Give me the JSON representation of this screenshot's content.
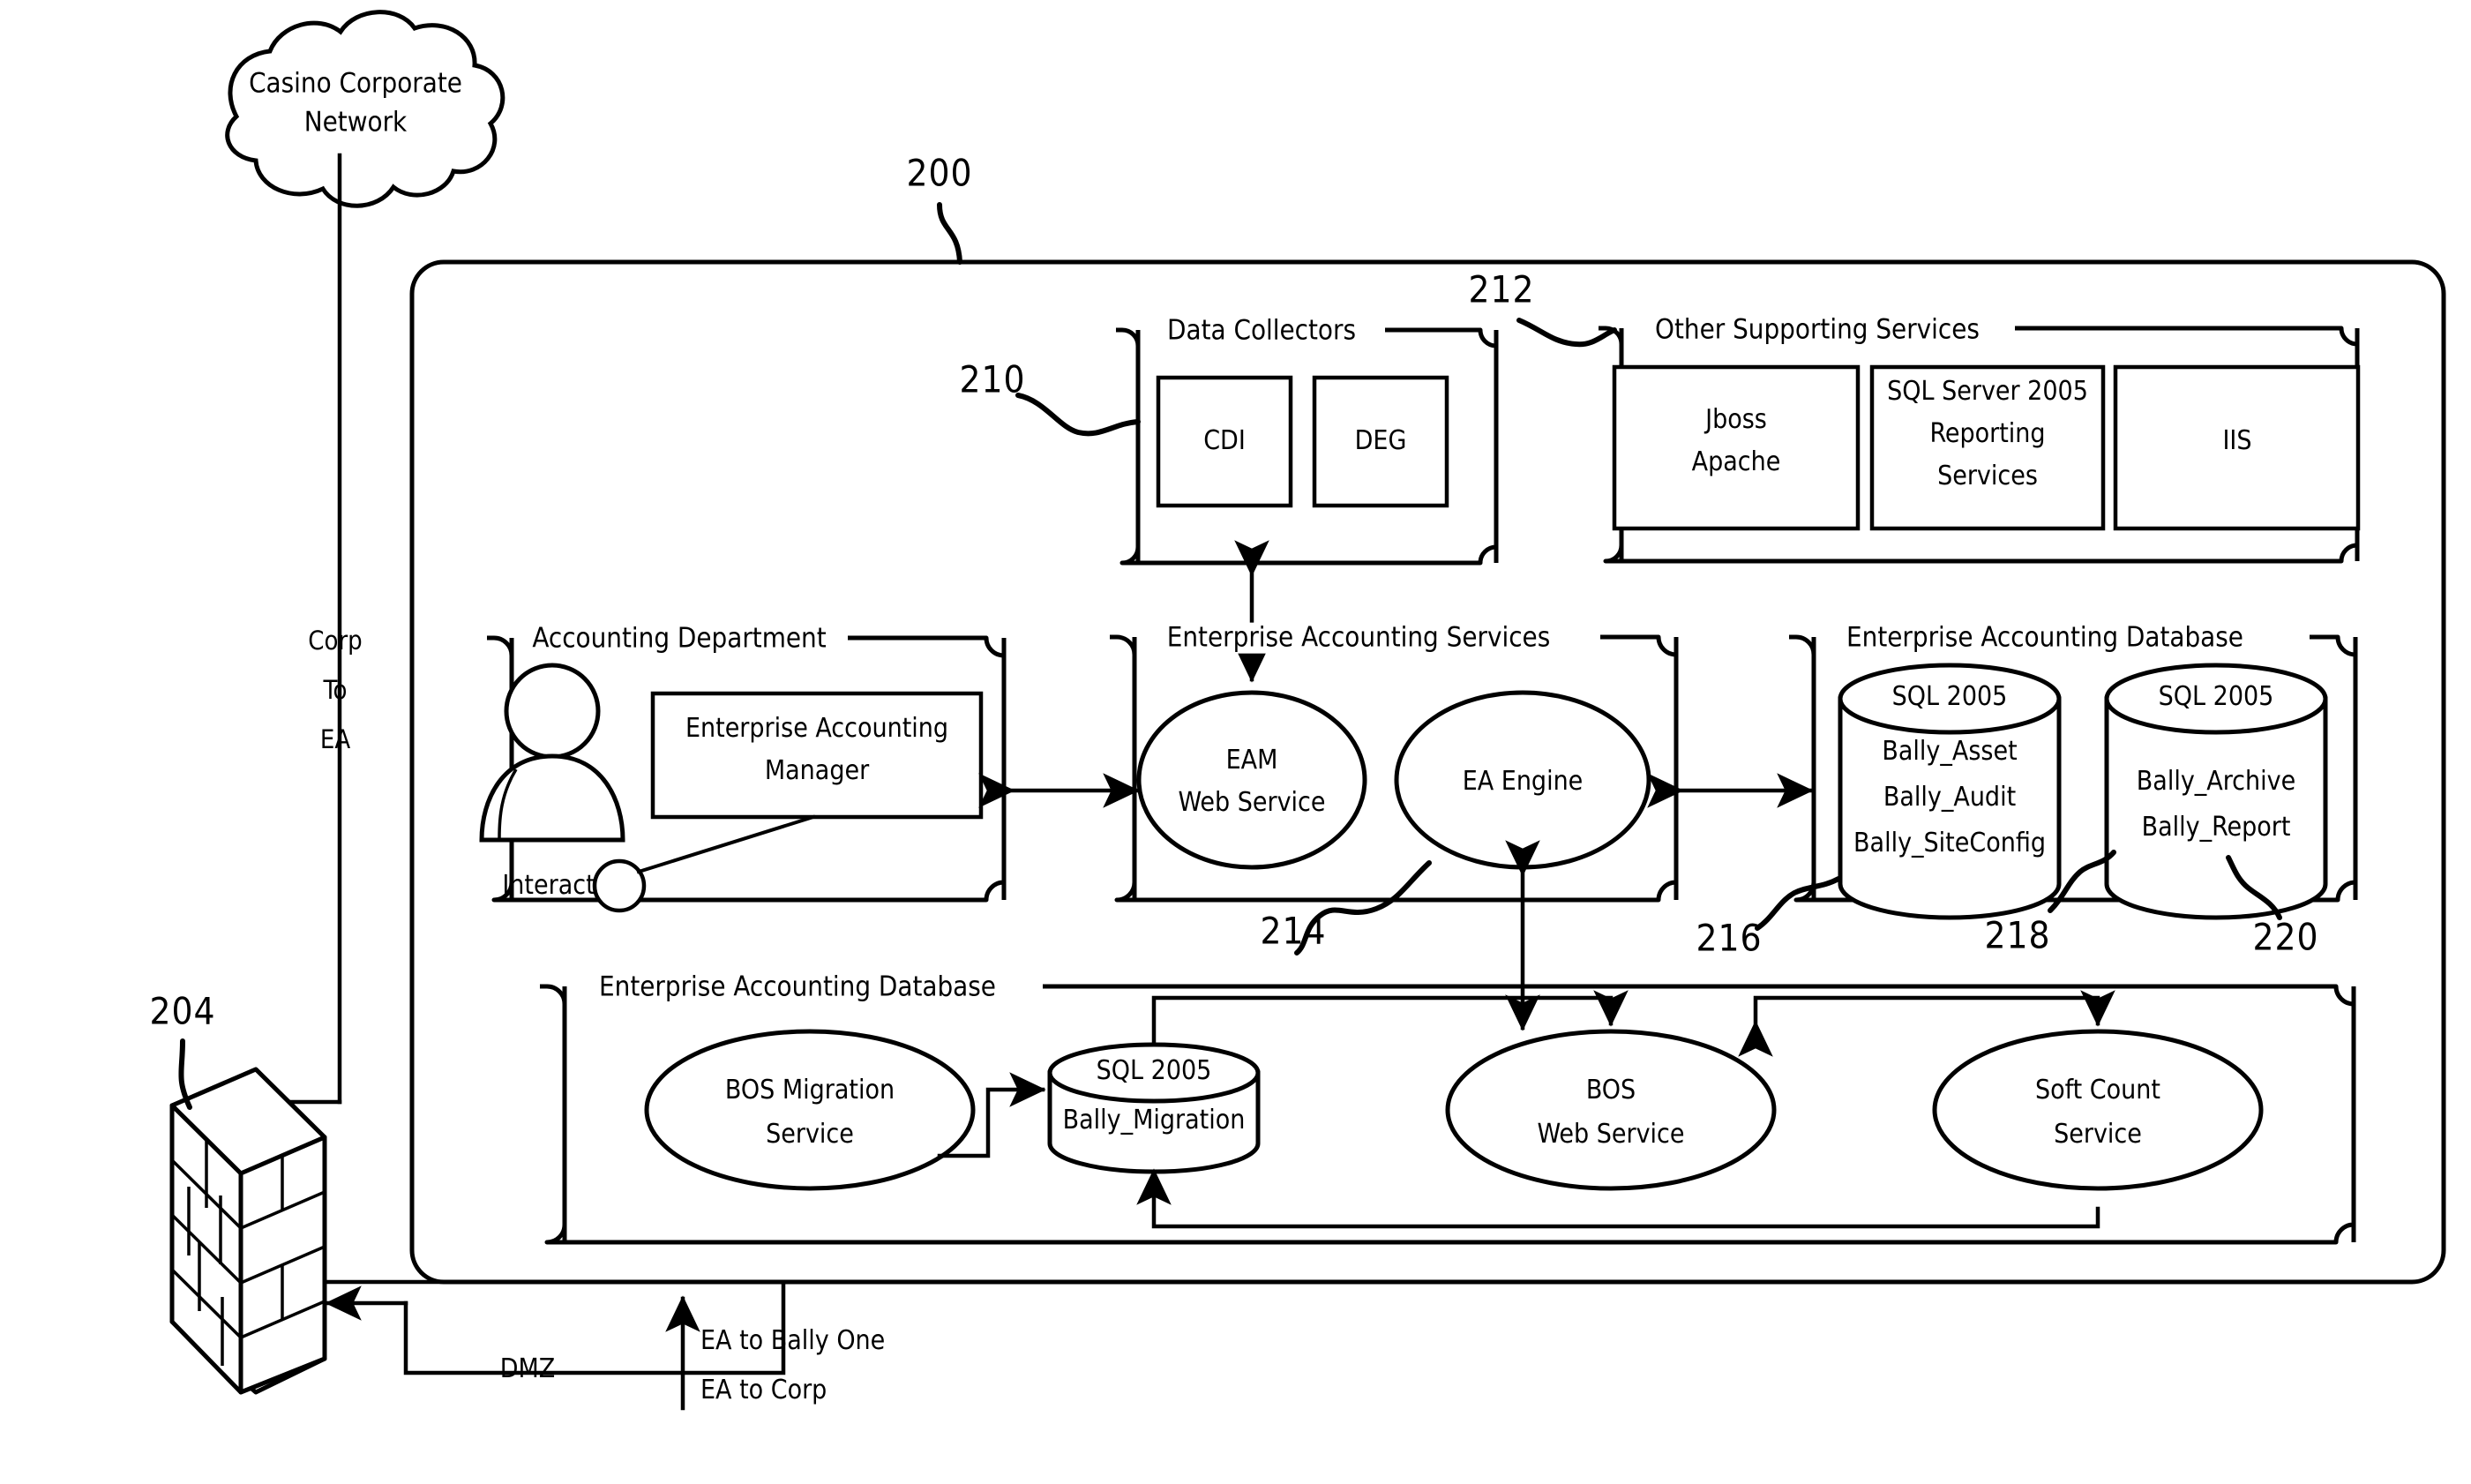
{
  "figure": {
    "type": "patent-architecture-diagram",
    "reference_numerals": {
      "system": "200",
      "firewall": "204",
      "data_collectors": "210",
      "other_supporting_services": "212",
      "enterprise_accounting_services": "214",
      "ea_database_primary": "216",
      "ea_database_group": "218",
      "ea_database_archive": "220"
    }
  },
  "external": {
    "cloud_label": "Casino Corporate\nNetwork",
    "cloud_line1": "Casino Corporate",
    "cloud_line2": "Network",
    "corp_to_ea": "Corp\nTo\nEA",
    "corp_to_ea_l1": "Corp",
    "corp_to_ea_l2": "To",
    "corp_to_ea_l3": "EA",
    "firewall_name": "firewall",
    "dmz_label": "DMZ",
    "ea_to_bally_one": "EA to Bally One",
    "ea_to_corp": "EA to Corp"
  },
  "groups": {
    "data_collectors": {
      "title": "Data Collectors",
      "ref": "210",
      "nodes": [
        {
          "label": "CDI"
        },
        {
          "label": "DEG"
        }
      ]
    },
    "other_supporting_services": {
      "title": "Other Supporting Services",
      "ref": "212",
      "nodes": [
        {
          "label": "Jboss\nApache",
          "l1": "Jboss",
          "l2": "Apache"
        },
        {
          "label": "SQL Server 2005\nReporting\nServices",
          "l1": "SQL Server 2005",
          "l2": "Reporting",
          "l3": "Services"
        },
        {
          "label": "IIS",
          "l1": "IIS"
        }
      ]
    },
    "accounting_department": {
      "title": "Accounting Department",
      "actor_label": "Interact",
      "nodes": [
        {
          "label": "Enterprise Accounting\nManager",
          "l1": "Enterprise Accounting",
          "l2": "Manager"
        }
      ]
    },
    "enterprise_accounting_services": {
      "title": "Enterprise Accounting Services",
      "ref": "214",
      "nodes": [
        {
          "label": "EAM\nWeb Service",
          "l1": "EAM",
          "l2": "Web Service"
        },
        {
          "label": "EA Engine",
          "l1": "EA Engine"
        }
      ]
    },
    "enterprise_accounting_database_right": {
      "title": "Enterprise Accounting Database",
      "ref": "218",
      "nodes": [
        {
          "ref": "216",
          "header": "SQL 2005",
          "lines": [
            "Bally_Asset",
            "Bally_Audit",
            "Bally_SiteConfig"
          ]
        },
        {
          "ref": "220",
          "header": "SQL 2005",
          "lines": [
            "Bally_Archive",
            "Bally_Report"
          ]
        }
      ]
    },
    "enterprise_accounting_database_bottom": {
      "title": "Enterprise Accounting Database",
      "nodes": [
        {
          "kind": "ellipse",
          "label": "BOS Migration\nService",
          "l1": "BOS Migration",
          "l2": "Service"
        },
        {
          "kind": "cylinder",
          "header": "SQL 2005",
          "lines": [
            "Bally_Migration"
          ]
        },
        {
          "kind": "ellipse",
          "label": "BOS\nWeb Service",
          "l1": "BOS",
          "l2": "Web Service"
        },
        {
          "kind": "ellipse",
          "label": "Soft Count\nService",
          "l1": "Soft Count",
          "l2": "Service"
        }
      ]
    }
  },
  "colors": {
    "stroke": "#000000",
    "background": "#ffffff"
  }
}
